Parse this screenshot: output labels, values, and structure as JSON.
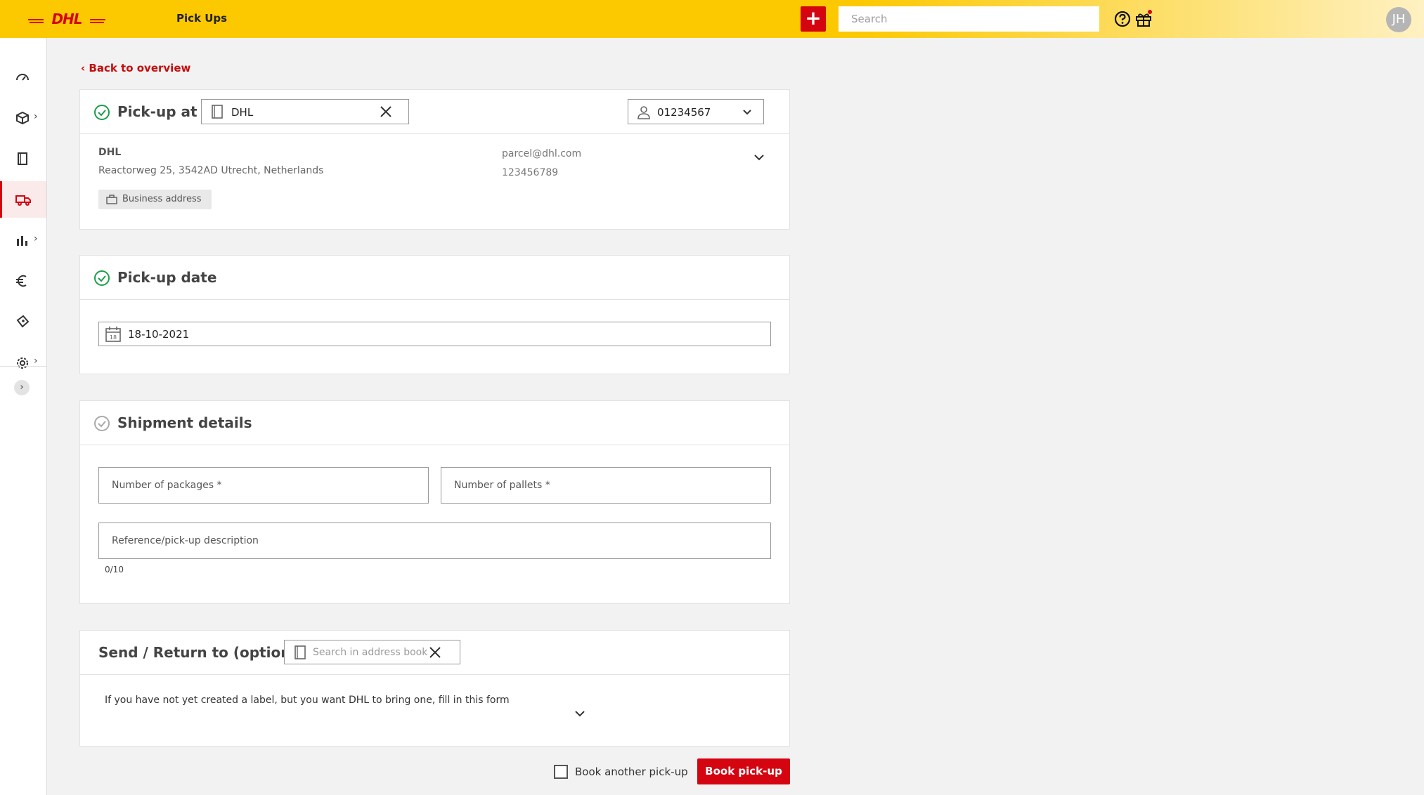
{
  "header": {
    "logo_text": "DHL",
    "page_title": "Pick Ups",
    "add_label": "+",
    "search_placeholder": "Search",
    "avatar_initials": "JH",
    "accent": "#d40511",
    "brand_yellow": "#fcc800"
  },
  "sidebar": {
    "items": [
      {
        "icon": "gauge-icon"
      },
      {
        "icon": "package-icon",
        "has_chevron": true
      },
      {
        "icon": "document-icon"
      },
      {
        "icon": "truck-icon",
        "active": true
      },
      {
        "icon": "bar-chart-icon",
        "has_chevron": true
      },
      {
        "icon": "euro-icon"
      },
      {
        "icon": "ticket-icon"
      },
      {
        "icon": "gear-icon",
        "has_chevron": true
      }
    ],
    "expand_label": "›"
  },
  "back_link": "Back to overview",
  "pickup_at": {
    "title": "Pick-up at",
    "address_value": "DHL",
    "account_value": "01234567",
    "name": "DHL",
    "address_line": "Reactorweg 25, 3542AD Utrecht, Netherlands",
    "tag": "Business address",
    "email": "parcel@dhl.com",
    "phone": "123456789"
  },
  "pickup_date": {
    "title": "Pick-up date",
    "value": "18-10-2021",
    "calendar_day": "18"
  },
  "shipment": {
    "title": "Shipment details",
    "packages_placeholder": "Number of packages *",
    "pallets_placeholder": "Number of pallets *",
    "reference_placeholder": "Reference/pick-up description",
    "counter": "0/10"
  },
  "send_return": {
    "title": "Send / Return to (optional)",
    "search_placeholder": "Search in address book",
    "note": "If you have not yet created a label, but you want DHL to bring one, fill in this form"
  },
  "footer": {
    "another_label": "Book another pick-up",
    "book_label": "Book pick-up"
  }
}
